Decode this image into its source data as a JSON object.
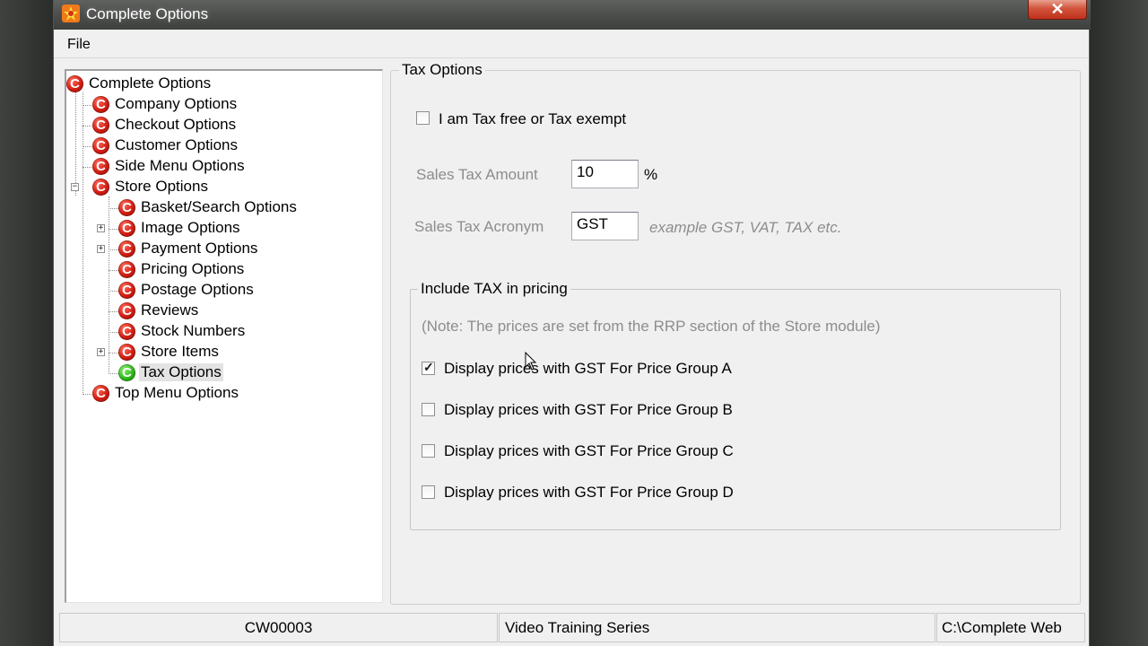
{
  "window": {
    "title": "Complete Options",
    "close_glyph": "✕"
  },
  "menu": {
    "file_label": "File"
  },
  "tree": {
    "items": [
      {
        "label": "Complete Options",
        "icon": "c-logo-red-icon"
      },
      {
        "label": "Company Options",
        "icon": "c-logo-red-icon"
      },
      {
        "label": "Checkout Options",
        "icon": "c-logo-red-icon"
      },
      {
        "label": "Customer Options",
        "icon": "c-logo-red-icon"
      },
      {
        "label": "Side Menu Options",
        "icon": "c-logo-red-icon"
      },
      {
        "label": "Store Options",
        "icon": "c-logo-red-icon",
        "expander": "−"
      },
      {
        "label": "Basket/Search Options",
        "icon": "c-logo-red-icon"
      },
      {
        "label": "Image Options",
        "icon": "c-logo-red-icon",
        "expander": "+"
      },
      {
        "label": "Payment Options",
        "icon": "c-logo-red-icon",
        "expander": "+"
      },
      {
        "label": "Pricing Options",
        "icon": "c-logo-red-icon"
      },
      {
        "label": "Postage Options",
        "icon": "c-logo-red-icon"
      },
      {
        "label": "Reviews",
        "icon": "c-logo-red-icon"
      },
      {
        "label": "Stock Numbers",
        "icon": "c-logo-red-icon"
      },
      {
        "label": "Store Items",
        "icon": "c-logo-red-icon",
        "expander": "+"
      },
      {
        "label": "Tax Options",
        "icon": "c-logo-green-icon",
        "selected": true
      },
      {
        "label": "Top Menu Options",
        "icon": "c-logo-red-icon"
      }
    ]
  },
  "tax": {
    "group_title": "Tax Options",
    "tax_free_label": "I am Tax free or Tax exempt",
    "tax_free_checked": false,
    "sales_tax_amount_label": "Sales Tax Amount",
    "sales_tax_amount_value": "10",
    "percent_sign": "%",
    "sales_tax_acronym_label": "Sales Tax Acronym",
    "sales_tax_acronym_value": "GST",
    "acronym_hint": "example GST, VAT, TAX etc.",
    "include": {
      "group_title": "Include TAX in pricing",
      "note": "(Note: The prices are set from the RRP section of the Store module)",
      "options": [
        {
          "label": "Display prices with GST For Price Group A",
          "checked": true
        },
        {
          "label": "Display prices with GST For Price Group B",
          "checked": false
        },
        {
          "label": "Display prices with GST For Price Group C",
          "checked": false
        },
        {
          "label": "Display prices with GST For Price Group D",
          "checked": false
        }
      ]
    }
  },
  "status": {
    "code": "CW00003",
    "series": "Video Training Series",
    "path": "C:\\Complete Web"
  },
  "colors": {
    "c_logo_red": "#d21d12",
    "c_logo_green": "#2fb81b",
    "close_red": "#c0301c",
    "disabled_text": "#8d8d8d"
  }
}
